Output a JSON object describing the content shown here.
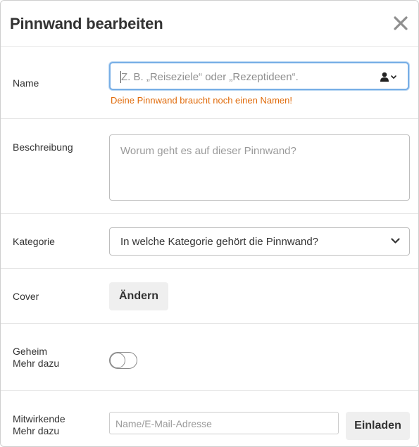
{
  "dialog": {
    "title": "Pinnwand bearbeiten"
  },
  "name": {
    "label": "Name",
    "placeholder": "Z. B. „Reiseziele“ oder „Rezeptideen“.",
    "value": "",
    "error": "Deine Pinnwand braucht noch einen Namen!"
  },
  "description": {
    "label": "Beschreibung",
    "placeholder": "Worum geht es auf dieser Pinnwand?",
    "value": ""
  },
  "category": {
    "label": "Kategorie",
    "selected": "In welche Kategorie gehört die Pinnwand?"
  },
  "cover": {
    "label": "Cover",
    "button_label": "Ändern"
  },
  "secret": {
    "label": "Geheim",
    "more_link": "Mehr dazu",
    "enabled": false
  },
  "collaborators": {
    "label": "Mitwirkende",
    "more_link": "Mehr dazu",
    "placeholder": "Name/E-Mail-Adresse",
    "value": "",
    "invite_button": "Einladen"
  },
  "icons": {
    "close": "close-icon",
    "user_menu": "person-icon",
    "chevron": "chevron-down-icon"
  },
  "colors": {
    "error": "#e06b0b",
    "focus_border": "#77aee6",
    "button_bg": "#efefef"
  }
}
